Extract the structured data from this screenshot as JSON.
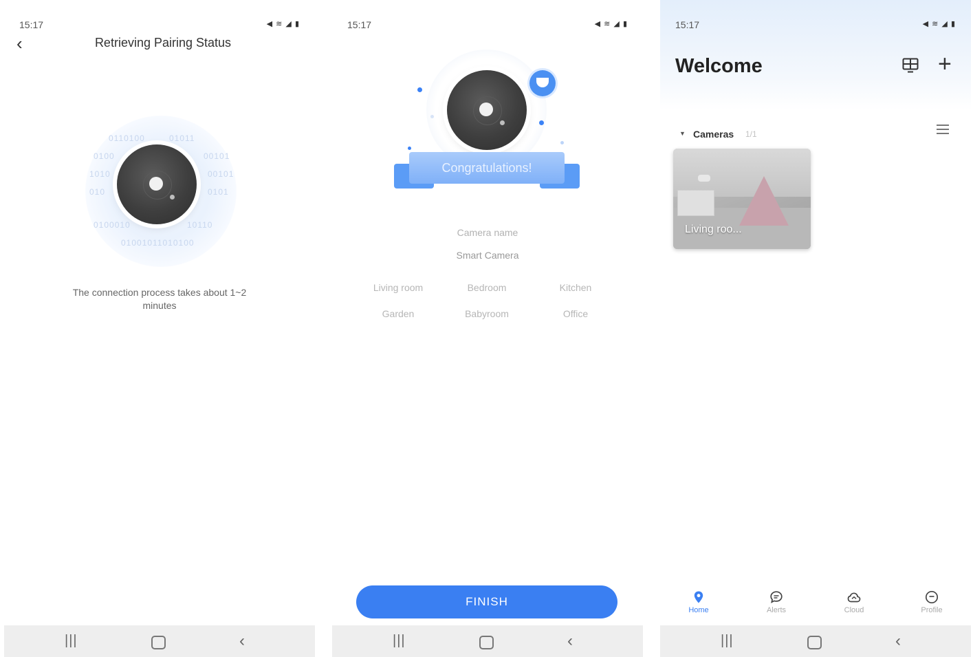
{
  "status_bar": {
    "time": "15:17",
    "icons": "◀ ≋ ◢ ▮"
  },
  "nav_bar": {
    "recents": "|||",
    "back": "‹"
  },
  "screen1": {
    "back_icon": "‹",
    "title": "Retrieving Pairing Status",
    "binary_rows": [
      "0110100",
      "01011",
      "0100",
      "00101",
      "00101",
      "1010",
      "010",
      "0101",
      "0100010",
      "10110",
      "01001011010100"
    ],
    "hint": "The connection process takes about 1~2 minutes"
  },
  "screen2": {
    "banner": "Congratulations!",
    "camera_name_label": "Camera name",
    "camera_name_value": "Smart Camera",
    "rooms": [
      "Living room",
      "Bedroom",
      "Kitchen",
      "Garden",
      "Babyroom",
      "Office"
    ],
    "finish_label": "FINISH"
  },
  "screen3": {
    "title": "Welcome",
    "plus_icon": "+",
    "section_arrow": "▼",
    "section_label": "Cameras",
    "section_count": "1/1",
    "camera_card_label": "Living roo...",
    "tabs": [
      {
        "label": "Home",
        "icon": "location-pin-icon",
        "active": true
      },
      {
        "label": "Alerts",
        "icon": "chat-bubble-icon",
        "active": false
      },
      {
        "label": "Cloud",
        "icon": "cloud-icon",
        "active": false
      },
      {
        "label": "Profile",
        "icon": "profile-icon",
        "active": false
      }
    ]
  },
  "colors": {
    "accent": "#3a7ff2",
    "banner": "#7fb0f8",
    "lens": "#3e3e3e"
  }
}
